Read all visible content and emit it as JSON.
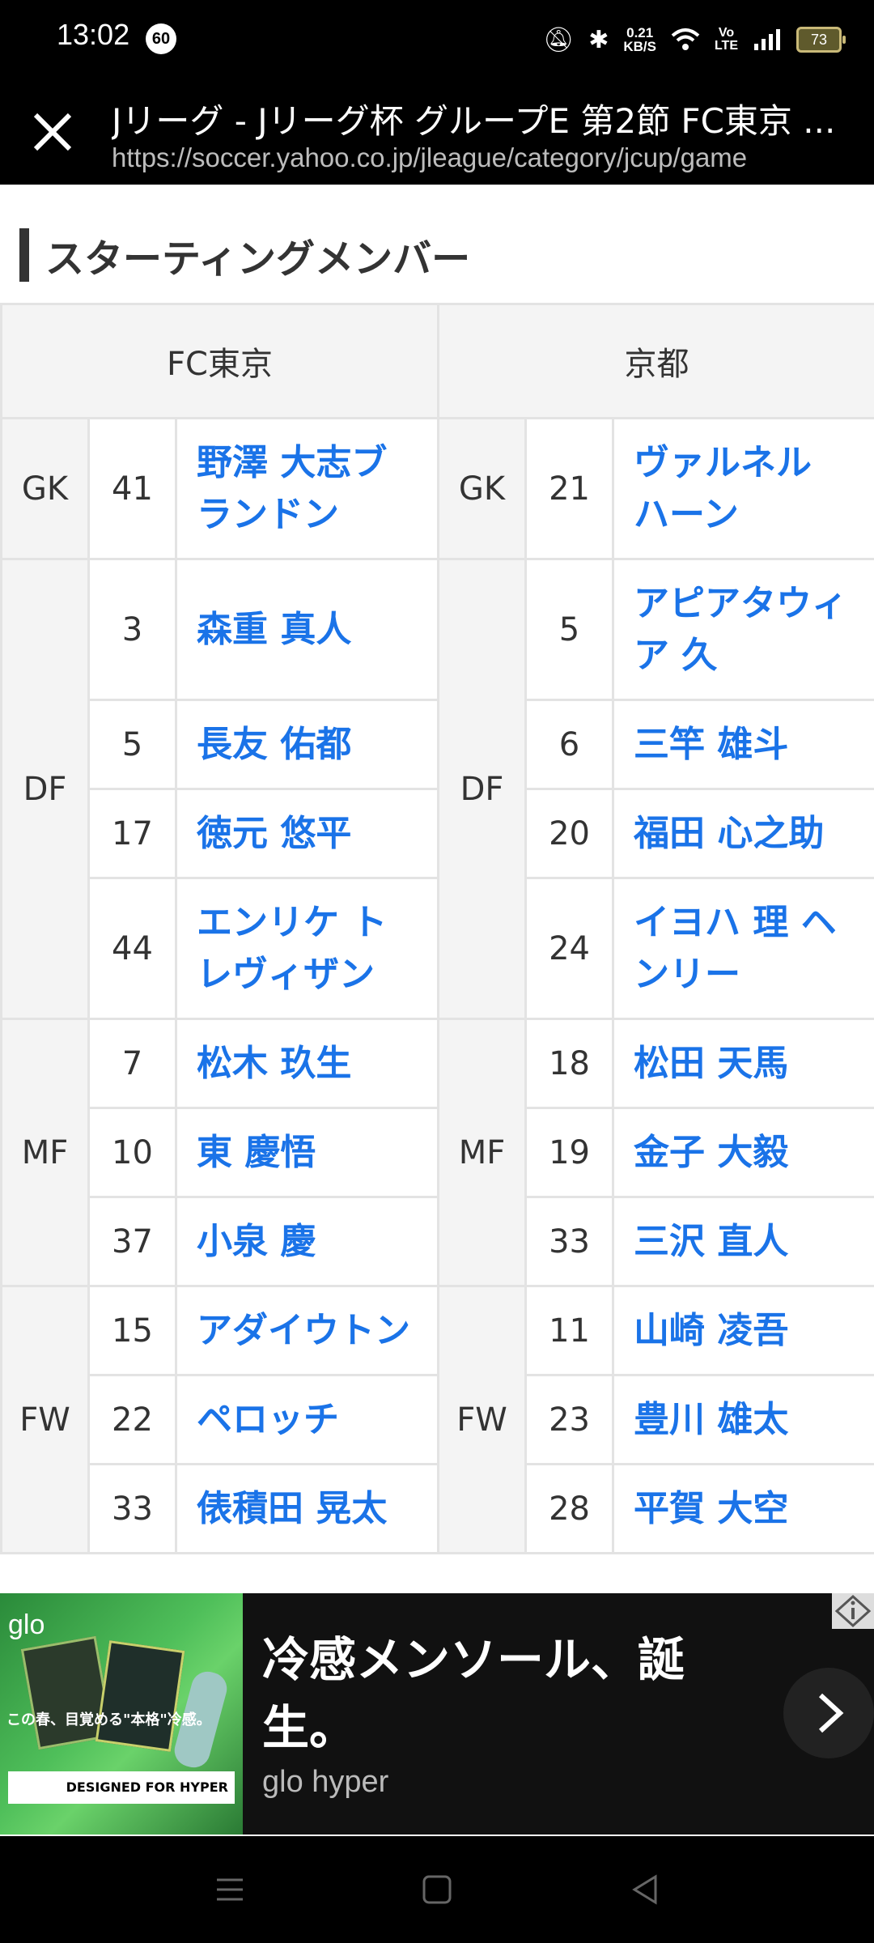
{
  "status_bar": {
    "time": "13:02",
    "notification_count": "60",
    "net_speed_value": "0.21",
    "net_speed_unit": "KB/S",
    "volte_line1": "Vo",
    "volte_line2": "LTE",
    "battery": "73"
  },
  "browser": {
    "title": "Jリーグ - Jリーグ杯 グループE 第2節 FC東京 ...",
    "url": "https://soccer.yahoo.co.jp/jleague/category/jcup/game"
  },
  "section": {
    "title": "スターティングメンバー"
  },
  "lineup": {
    "home_team": "FC東京",
    "away_team": "京都",
    "positions": [
      "GK",
      "DF",
      "MF",
      "FW"
    ],
    "home": [
      {
        "position": "GK",
        "number": "41",
        "name": "野澤 大志ブランドン"
      },
      {
        "position": "DF",
        "number": "3",
        "name": "森重 真人"
      },
      {
        "position": "DF",
        "number": "5",
        "name": "長友 佑都"
      },
      {
        "position": "DF",
        "number": "17",
        "name": "徳元 悠平"
      },
      {
        "position": "DF",
        "number": "44",
        "name": "エンリケ トレヴィザン"
      },
      {
        "position": "MF",
        "number": "7",
        "name": "松木 玖生"
      },
      {
        "position": "MF",
        "number": "10",
        "name": "東 慶悟"
      },
      {
        "position": "MF",
        "number": "37",
        "name": "小泉 慶"
      },
      {
        "position": "FW",
        "number": "15",
        "name": "アダイウトン"
      },
      {
        "position": "FW",
        "number": "22",
        "name": "ペロッチ"
      },
      {
        "position": "FW",
        "number": "33",
        "name": "俵積田 晃太"
      }
    ],
    "away": [
      {
        "position": "GK",
        "number": "21",
        "name": "ヴァルネル ハーン"
      },
      {
        "position": "DF",
        "number": "5",
        "name": "アピアタウィア 久"
      },
      {
        "position": "DF",
        "number": "6",
        "name": "三竿 雄斗"
      },
      {
        "position": "DF",
        "number": "20",
        "name": "福田 心之助"
      },
      {
        "position": "DF",
        "number": "24",
        "name": "イヨハ 理 ヘンリー"
      },
      {
        "position": "MF",
        "number": "18",
        "name": "松田 天馬"
      },
      {
        "position": "MF",
        "number": "19",
        "name": "金子 大毅"
      },
      {
        "position": "MF",
        "number": "33",
        "name": "三沢 直人"
      },
      {
        "position": "FW",
        "number": "11",
        "name": "山崎 凌吾"
      },
      {
        "position": "FW",
        "number": "23",
        "name": "豊川 雄太"
      },
      {
        "position": "FW",
        "number": "28",
        "name": "平賀 大空"
      }
    ]
  },
  "ad": {
    "brand": "glo",
    "promo_text": "この春、目覚める\"本格\"冷感。",
    "designed_text": "DESIGNED FOR HYPER",
    "headline": "冷感メンソール、誕生。",
    "sponsor": "glo hyper"
  },
  "icons": {
    "close": "close-icon",
    "next": "chevron-right-icon",
    "info": "ad-info-icon",
    "nav_menu": "menu-icon",
    "nav_home": "home-icon",
    "nav_back": "back-icon"
  },
  "colors": {
    "link": "#1a73e8",
    "header_bg": "#000000",
    "cell_bg": "#f4f4f4"
  }
}
